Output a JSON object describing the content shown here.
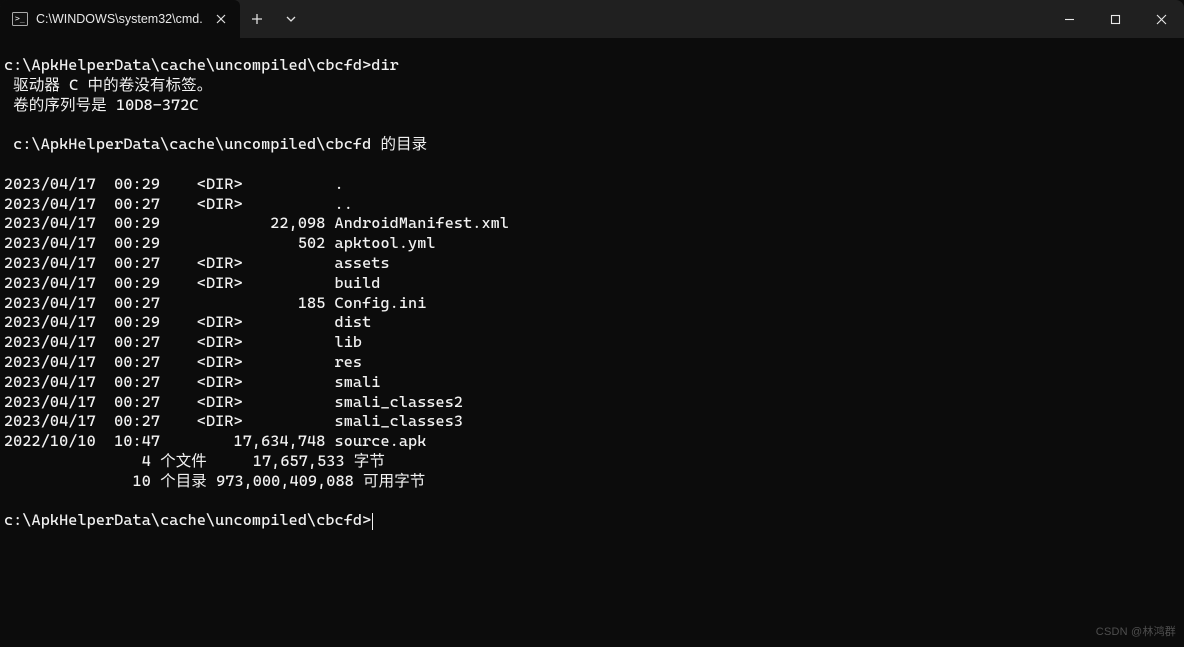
{
  "tab": {
    "title": "C:\\WINDOWS\\system32\\cmd."
  },
  "window_controls": {
    "minimize": "—",
    "maximize": "□",
    "close": "×"
  },
  "terminal": {
    "prompt1": "c:\\ApkHelperData\\cache\\uncompiled\\cbcfd>",
    "cmd1": "dir",
    "line_volume": " 驱动器 C 中的卷没有标签。",
    "line_serial": " 卷的序列号是 10D8-372C",
    "blank": "",
    "line_dirof": " c:\\ApkHelperData\\cache\\uncompiled\\cbcfd 的目录",
    "rows": [
      "2023/04/17  00:29    <DIR>          .",
      "2023/04/17  00:27    <DIR>          ..",
      "2023/04/17  00:29            22,098 AndroidManifest.xml",
      "2023/04/17  00:29               502 apktool.yml",
      "2023/04/17  00:27    <DIR>          assets",
      "2023/04/17  00:29    <DIR>          build",
      "2023/04/17  00:27               185 Config.ini",
      "2023/04/17  00:29    <DIR>          dist",
      "2023/04/17  00:27    <DIR>          lib",
      "2023/04/17  00:27    <DIR>          res",
      "2023/04/17  00:27    <DIR>          smali",
      "2023/04/17  00:27    <DIR>          smali_classes2",
      "2023/04/17  00:27    <DIR>          smali_classes3",
      "2022/10/10  10:47        17,634,748 source.apk"
    ],
    "summary_files": "               4 个文件     17,657,533 字节",
    "summary_dirs": "              10 个目录 973,000,409,088 可用字节",
    "prompt2": "c:\\ApkHelperData\\cache\\uncompiled\\cbcfd>"
  },
  "watermark": "CSDN @林鸿群"
}
